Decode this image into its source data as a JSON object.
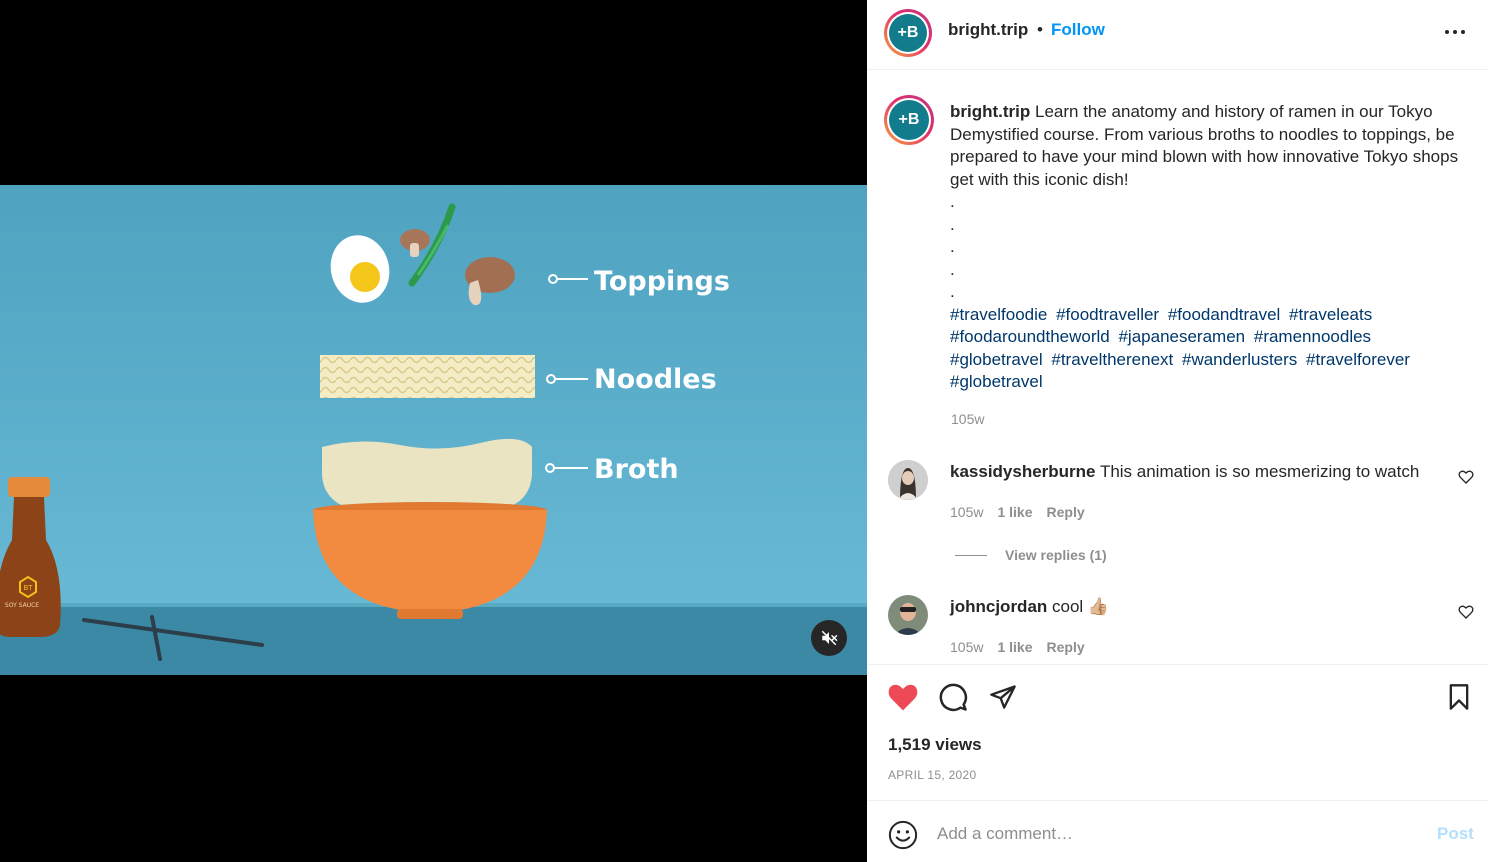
{
  "post": {
    "username": "bright.trip",
    "separator": "•",
    "follow_label": "Follow",
    "avatar_letter": "+B",
    "more_icon": "more-horizontal-icon"
  },
  "video": {
    "labels": [
      "Toppings",
      "Noodles",
      "Broth"
    ],
    "bottle_text": "SOY SAUCE",
    "bottle_logo": "BT",
    "mute_icon": "muted-speaker-icon",
    "colors": {
      "background": "#4aa6c4",
      "table": "#3a88a4",
      "bowl": "#f28a3f",
      "broth": "#e9e2c0"
    }
  },
  "caption": {
    "username": "bright.trip",
    "text": "Learn the anatomy and history of ramen in our Tokyo Demystified course. From various broths to noodles to toppings, be prepared to have your mind blown with how innovative Tokyo shops get with this iconic dish!",
    "dots": [
      ".",
      ".",
      ".",
      ".",
      "."
    ],
    "hashtags": [
      "#travelfoodie",
      "#foodtraveller",
      "#foodandtravel",
      "#traveleats",
      "#foodaroundtheworld",
      "#japaneseramen",
      "#ramennoodles",
      "#globetravel",
      "#traveltherenext",
      "#wanderlusters",
      "#travelforever",
      "#globetravel"
    ],
    "time": "105w"
  },
  "comments": [
    {
      "username": "kassidysherburne",
      "text": "This animation is so mesmerizing to watch",
      "time": "105w",
      "likes": "1 like",
      "reply": "Reply"
    },
    {
      "username": "johncjordan",
      "text": "cool 👍🏼",
      "time": "105w",
      "likes": "1 like",
      "reply": "Reply"
    }
  ],
  "view_replies": "View replies (1)",
  "stats": {
    "views": "1,519 views",
    "date": "APRIL 15, 2020"
  },
  "comment_box": {
    "placeholder": "Add a comment…",
    "post_label": "Post"
  },
  "colors": {
    "accent": "#0095f6",
    "liked": "#ed4956",
    "hashtag": "#00376b",
    "muted": "#8e8e8e",
    "post_disabled": "#b2dffc"
  }
}
